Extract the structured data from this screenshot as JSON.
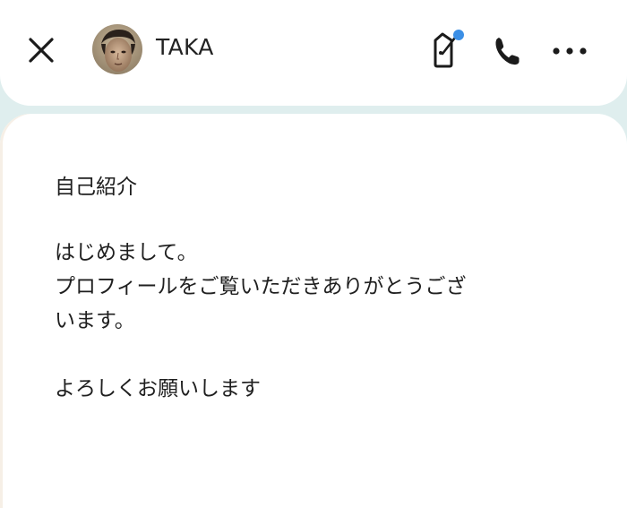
{
  "header": {
    "username": "TAKA",
    "close_icon": "close-icon",
    "tag_icon": "tag-icon",
    "phone_icon": "phone-icon",
    "more_icon": "more-horizontal-icon",
    "notification_dot_color": "#3b8fe6"
  },
  "profile": {
    "section_title": "自己紹介",
    "intro_text": "はじめまして。\nプロフィールをご覧いただきありがとうござ\nいます。\n\nよろしくお願いします"
  },
  "colors": {
    "background": "#dfeeee",
    "card": "#ffffff",
    "text": "#1f1f1f"
  }
}
